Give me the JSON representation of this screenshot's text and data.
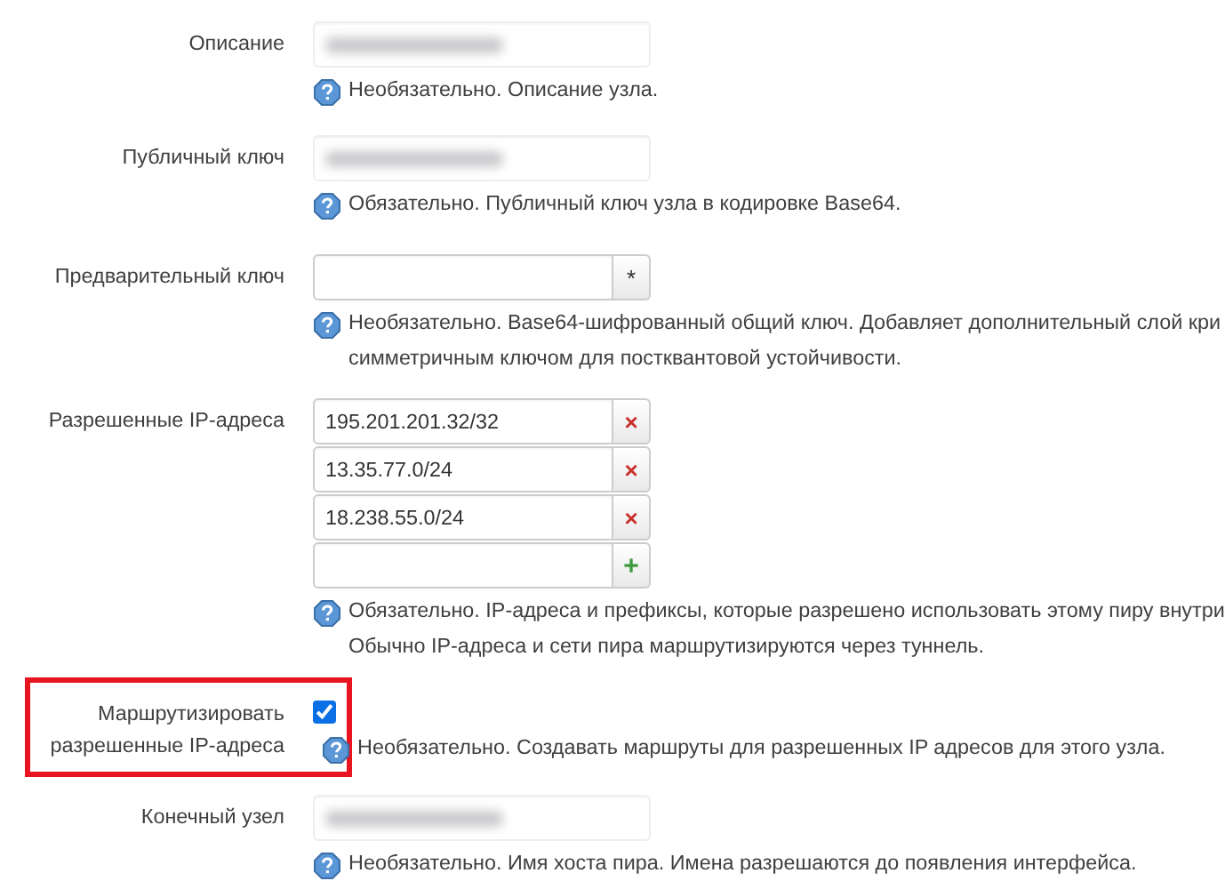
{
  "fields": [
    {
      "kind": "text",
      "label": "Описание",
      "blurred": true,
      "help": [
        "Необязательно. Описание узла."
      ]
    },
    {
      "kind": "text",
      "label": "Публичный ключ",
      "blurred": true,
      "help": [
        "Обязательно. Публичный ключ узла в кодировке Base64."
      ]
    },
    {
      "kind": "password",
      "label": "Предварительный ключ",
      "button": "*",
      "help": [
        "Необязательно. Base64-шифрованный общий ключ. Добавляет дополнительный слой кри",
        "симметричным ключом для постквантовой устойчивости."
      ]
    },
    {
      "kind": "list",
      "label": "Разрешенные IP-адреса",
      "items": [
        {
          "value": "195.201.201.32/32",
          "button": "×"
        },
        {
          "value": "13.35.77.0/24",
          "button": "×"
        },
        {
          "value": "18.238.55.0/24",
          "button": "×"
        }
      ],
      "add_button": "+",
      "help": [
        "Обязательно. IP-адреса и префиксы, которые разрешено использовать этому пиру внутри",
        "Обычно IP-адреса и сети пира маршрутизируются через туннель."
      ]
    },
    {
      "kind": "checkbox",
      "label": "Маршрутизировать разрешенные IP-адреса",
      "checked": true,
      "highlighted": true,
      "help": [
        "Необязательно. Создавать маршруты для разрешенных IP адресов для этого узла."
      ]
    },
    {
      "kind": "text",
      "label": "Конечный узел",
      "blurred": true,
      "help": [
        "Необязательно. Имя хоста пира. Имена разрешаются до появления интерфейса."
      ]
    }
  ]
}
